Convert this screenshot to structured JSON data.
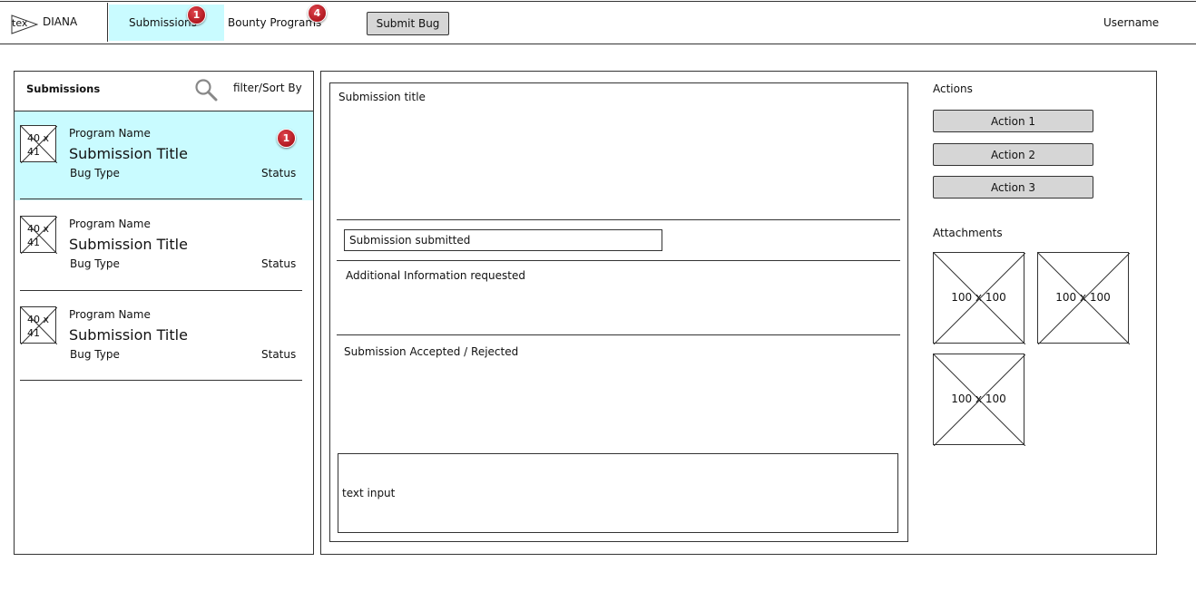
{
  "header": {
    "logo_text": "tex",
    "app_name": "DIANA",
    "tabs": [
      {
        "label": "Submissions",
        "badge": "1"
      },
      {
        "label": "Bounty Programs",
        "badge": "4"
      }
    ],
    "submit_button": "Submit Bug",
    "username": "Username"
  },
  "list": {
    "title": "Submissions",
    "filter_label": "filter/Sort By",
    "items": [
      {
        "thumb": "40 x 41",
        "program": "Program Name",
        "title": "Submission Title",
        "bug_type": "Bug Type",
        "status": "Status",
        "badge": "1"
      },
      {
        "thumb": "40 x 41",
        "program": "Program Name",
        "title": "Submission Title",
        "bug_type": "Bug Type",
        "status": "Status"
      },
      {
        "thumb": "40 x 41",
        "program": "Program Name",
        "title": "Submission Title",
        "bug_type": "Bug Type",
        "status": "Status"
      }
    ]
  },
  "detail": {
    "title": "Submission title",
    "submitted": "Submission submitted",
    "additional_info": "Additional Information requested",
    "accepted_rejected": "Submission Accepted / Rejected",
    "text_input": "text input"
  },
  "actions": {
    "label": "Actions",
    "buttons": [
      "Action 1",
      "Action 2",
      "Action 3"
    ]
  },
  "attachments": {
    "label": "Attachments",
    "items": [
      "100 x 100",
      "100 x 100",
      "100 x 100"
    ]
  },
  "colors": {
    "selected_bg": "#c9fbff",
    "badge": "#c0202a",
    "button_bg": "#d6d6d6"
  }
}
